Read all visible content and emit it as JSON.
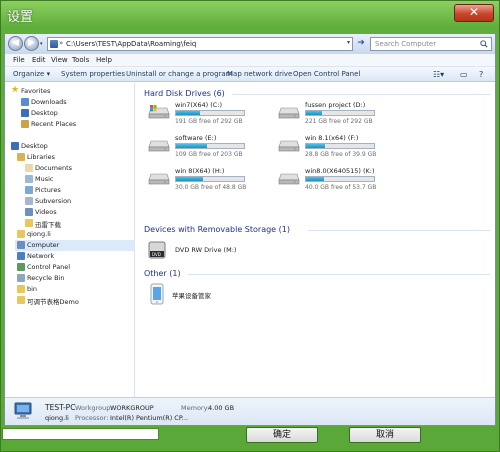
{
  "dialog": {
    "title": "设置",
    "close_label": "✕",
    "ok_label": "确定",
    "cancel_label": "取消"
  },
  "address": {
    "path": "C:\\Users\\TEST\\AppData\\Roaming\\feiq",
    "chevron": "»"
  },
  "search": {
    "placeholder": "Search Computer"
  },
  "menu": [
    "File",
    "Edit",
    "View",
    "Tools",
    "Help"
  ],
  "toolbar": {
    "organize": "Organize ▾",
    "system_properties": "System properties",
    "uninstall": "Uninstall or change a program",
    "map_drive": "Map network drive",
    "control_panel": "Open Control Panel"
  },
  "nav": {
    "favorites": "Favorites",
    "downloads": "Downloads",
    "desktop_fav": "Desktop",
    "recent_places": "Recent Places",
    "desktop": "Desktop",
    "libraries": "Libraries",
    "documents": "Documents",
    "music": "Music",
    "pictures": "Pictures",
    "subversion": "Subversion",
    "videos": "Videos",
    "xunlei": "迅雷下载",
    "user": "qiong.li",
    "computer": "Computer",
    "network": "Network",
    "control_panel": "Control Panel",
    "recycle_bin": "Recycle Bin",
    "bin": "bin",
    "demo": "可调节表格Demo"
  },
  "groups": {
    "hdd": "Hard Disk Drives (6)",
    "removable": "Devices with Removable Storage (1)",
    "other": "Other (1)"
  },
  "drives": [
    {
      "name": "win7(X64) (C:)",
      "free": "191 GB free of 292 GB",
      "used_pct": 35
    },
    {
      "name": "fussen project (D:)",
      "free": "221 GB free of 292 GB",
      "used_pct": 24
    },
    {
      "name": "software (E:)",
      "free": "109 GB free of 203 GB",
      "used_pct": 46
    },
    {
      "name": "win 8.1(x64) (F:)",
      "free": "28.8 GB free of 39.9 GB",
      "used_pct": 28
    },
    {
      "name": "win 8(X64) (H:)",
      "free": "30.0 GB free of 48.8 GB",
      "used_pct": 39
    },
    {
      "name": "win8.0(X640515) (K:)",
      "free": "40.0 GB free of 53.7 GB",
      "used_pct": 26
    }
  ],
  "dvd": {
    "name": "DVD RW Drive (M:)"
  },
  "other_device": {
    "name": "苹果设备管家"
  },
  "details": {
    "pc_name": "TEST-PC",
    "workgroup_label": "Workgroup:",
    "workgroup": "WORKGROUP",
    "memory_label": "Memory:",
    "memory": "4.00 GB",
    "user": "qiong.li",
    "processor_label": "Processor:",
    "processor": "Intel(R) Pentium(R) CP..."
  },
  "colors": {
    "accent": "#5aa838",
    "drive_fill": "#26a0da",
    "group_header": "#1e3287"
  }
}
